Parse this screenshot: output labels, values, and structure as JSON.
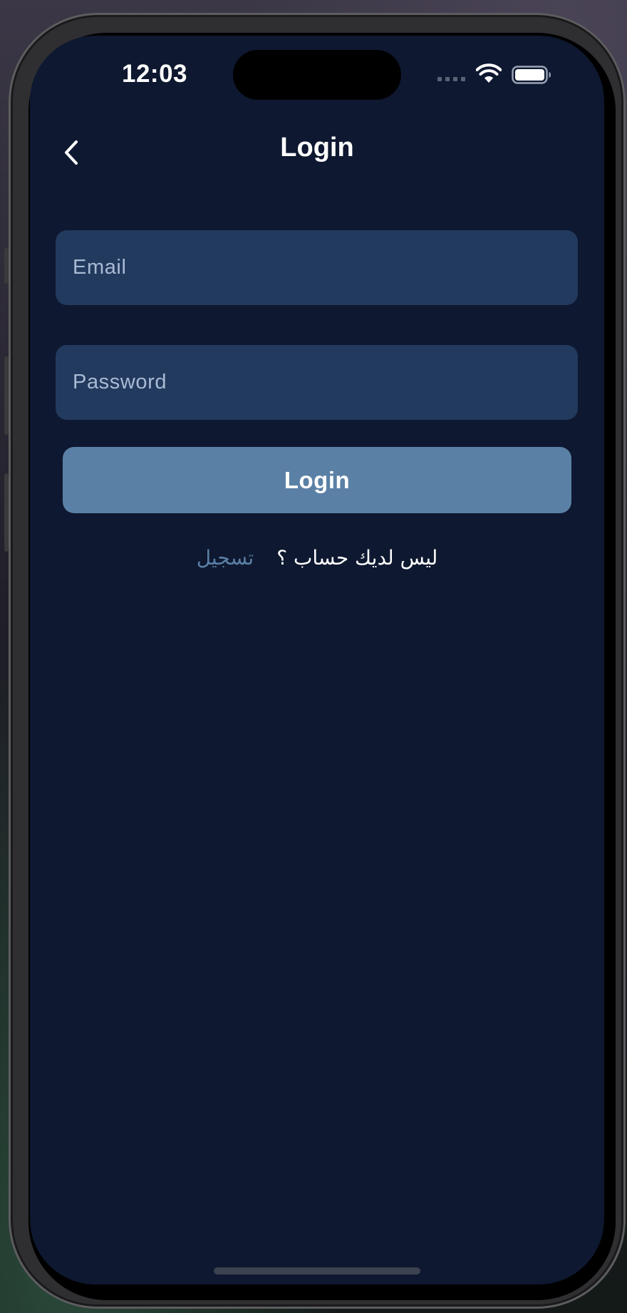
{
  "status_bar": {
    "time": "12:03"
  },
  "nav": {
    "title": "Login",
    "back_icon": "chevron-left-icon"
  },
  "form": {
    "email_placeholder": "Email",
    "email_value": "",
    "password_placeholder": "Password",
    "password_value": "",
    "login_label": "Login"
  },
  "signup": {
    "prompt": "ليس لديك حساب ؟",
    "link_label": "تسجيل"
  },
  "colors": {
    "background": "#0e1830",
    "input_background": "#223a5e",
    "accent": "#5b80a6",
    "text": "#ffffff"
  }
}
